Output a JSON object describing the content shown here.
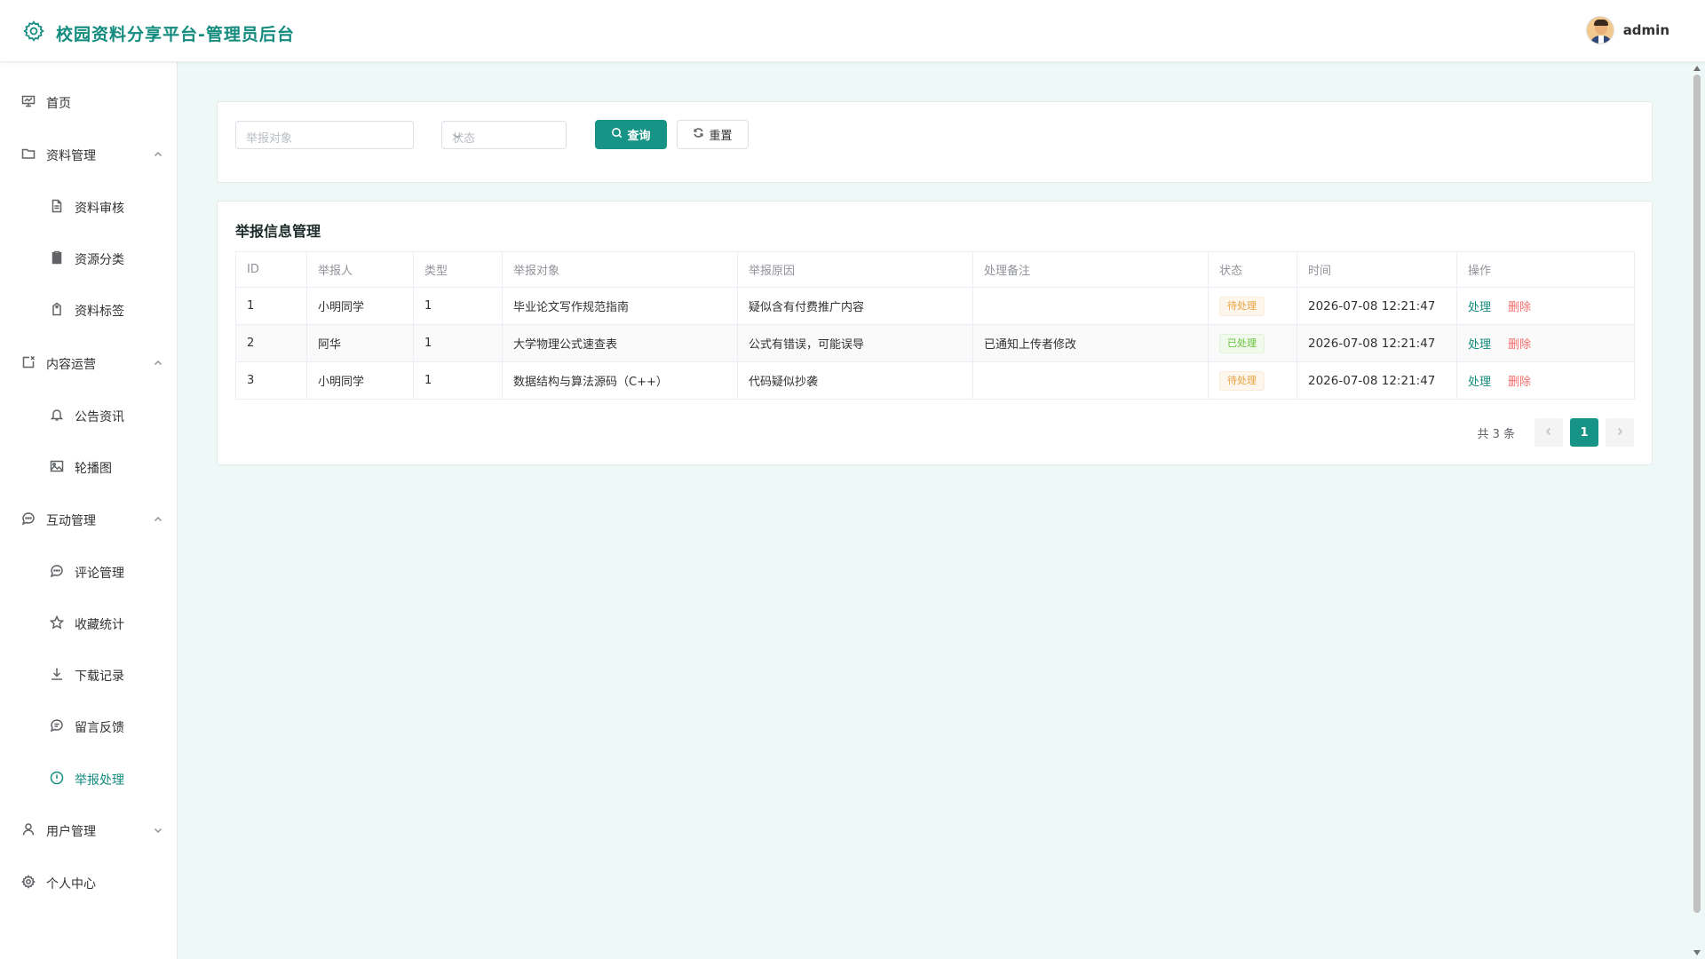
{
  "header": {
    "title": "校园资料分享平台-管理员后台",
    "user_name": "admin"
  },
  "sidebar": {
    "home": "首页",
    "groups": [
      {
        "label": "资料管理",
        "items": [
          "资料审核",
          "资源分类",
          "资料标签"
        ]
      },
      {
        "label": "内容运营",
        "items": [
          "公告资讯",
          "轮播图"
        ]
      },
      {
        "label": "互动管理",
        "items": [
          "评论管理",
          "收藏统计",
          "下载记录",
          "留言反馈",
          "举报处理"
        ]
      },
      {
        "label": "用户管理"
      }
    ],
    "profile": "个人中心"
  },
  "filter": {
    "target_placeholder": "举报对象",
    "status_placeholder": "状态",
    "search_label": "查询",
    "reset_label": "重置"
  },
  "table": {
    "title": "举报信息管理",
    "columns": [
      "ID",
      "举报人",
      "类型",
      "举报对象",
      "举报原因",
      "处理备注",
      "状态",
      "时间",
      "操作"
    ],
    "rows": [
      {
        "id": "1",
        "reporter": "小明同学",
        "type": "1",
        "target": "毕业论文写作规范指南",
        "reason": "疑似含有付费推广内容",
        "note": "",
        "status": "待处理",
        "time": "2026-07-08 12:21:47"
      },
      {
        "id": "2",
        "reporter": "阿华",
        "type": "1",
        "target": "大学物理公式速查表",
        "reason": "公式有错误，可能误导",
        "note": "已通知上传者修改",
        "status": "已处理",
        "time": "2026-07-08 12:21:47"
      },
      {
        "id": "3",
        "reporter": "小明同学",
        "type": "1",
        "target": "数据结构与算法源码（C++）",
        "reason": "代码疑似抄袭",
        "note": "",
        "status": "待处理",
        "time": "2026-07-08 12:21:47"
      }
    ],
    "actions": {
      "process": "处理",
      "delete": "删除"
    }
  },
  "pagination": {
    "total_text": "共 3 条",
    "current_page": "1"
  },
  "colors": {
    "accent": "#138b7e",
    "page_background": "#eef9f7",
    "pending": "#e6a23c",
    "done": "#67c23a",
    "danger": "#f56c6c"
  }
}
